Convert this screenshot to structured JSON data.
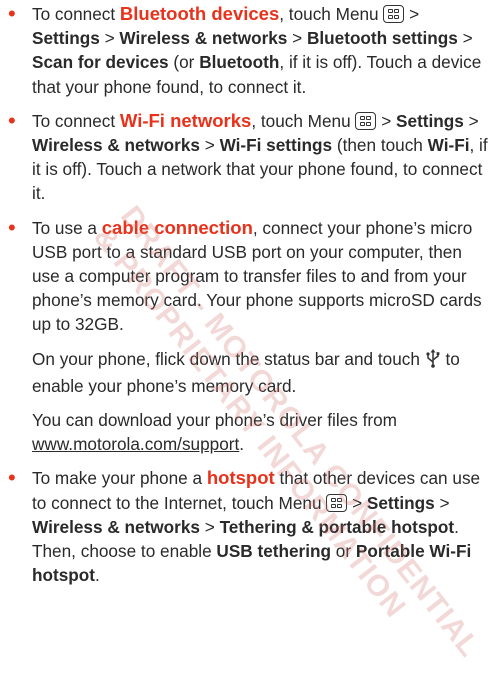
{
  "menu_icon": "menu-key-icon",
  "usb_icon": "usb-icon",
  "accent_color": "#e8321b",
  "watermark": {
    "line1": "DRAFT - MOTOROLA CONFIDENTIAL",
    "line2": "& PROPRIETARY INFORMATION"
  },
  "bluetooth": {
    "t1": "To connect ",
    "highlight": "Bluetooth devices",
    "t2": ", touch Menu ",
    "t3": " > ",
    "settings": "Settings",
    "t4": " > ",
    "wireless": "Wireless & networks",
    "t5": " > ",
    "bt_settings": "Bluetooth settings",
    "t6": " > ",
    "scan": "Scan for devices",
    "t7": " (or ",
    "bt": "Bluetooth",
    "t8": ", if it is off). Touch a device that your phone found, to connect it."
  },
  "wifi": {
    "t1": "To connect ",
    "highlight": "Wi-Fi networks",
    "t2": ", touch Menu ",
    "t3": " > ",
    "settings": "Settings",
    "t4": " > ",
    "wireless": "Wireless & networks",
    "t5": " > ",
    "wifi_settings": "Wi-Fi settings",
    "t6": " (then touch ",
    "wifi": "Wi-Fi",
    "t7": ", if it is off). Touch a network that your phone found, to connect it."
  },
  "cable": {
    "t1": "To use a ",
    "highlight": "cable connection",
    "t2": ", connect your phone’s micro USB port to a standard USB port on your computer, then use a computer program to transfer files to and from your phone’s memory card. Your phone supports microSD cards up to 32GB.",
    "p2_t1": "On your phone, flick down the status bar and touch ",
    "p2_t2": " to enable your phone’s memory card.",
    "p3_t1": "You can download your phone’s driver files from ",
    "p3_link": "www.motorola.com/support",
    "p3_t2": "."
  },
  "hotspot": {
    "t1": "To make your phone a ",
    "highlight": "hotspot",
    "t2": " that other devices can use to connect to the Internet, touch Menu ",
    "t3": " > ",
    "settings": "Settings",
    "t4": " > ",
    "wireless": "Wireless & networks",
    "t5": " > ",
    "tethering": "Tethering & portable hotspot",
    "t6": ". Then, choose to enable ",
    "usb": "USB tethering",
    "t7": " or ",
    "portable": "Portable Wi-Fi hotspot",
    "t8": "."
  }
}
